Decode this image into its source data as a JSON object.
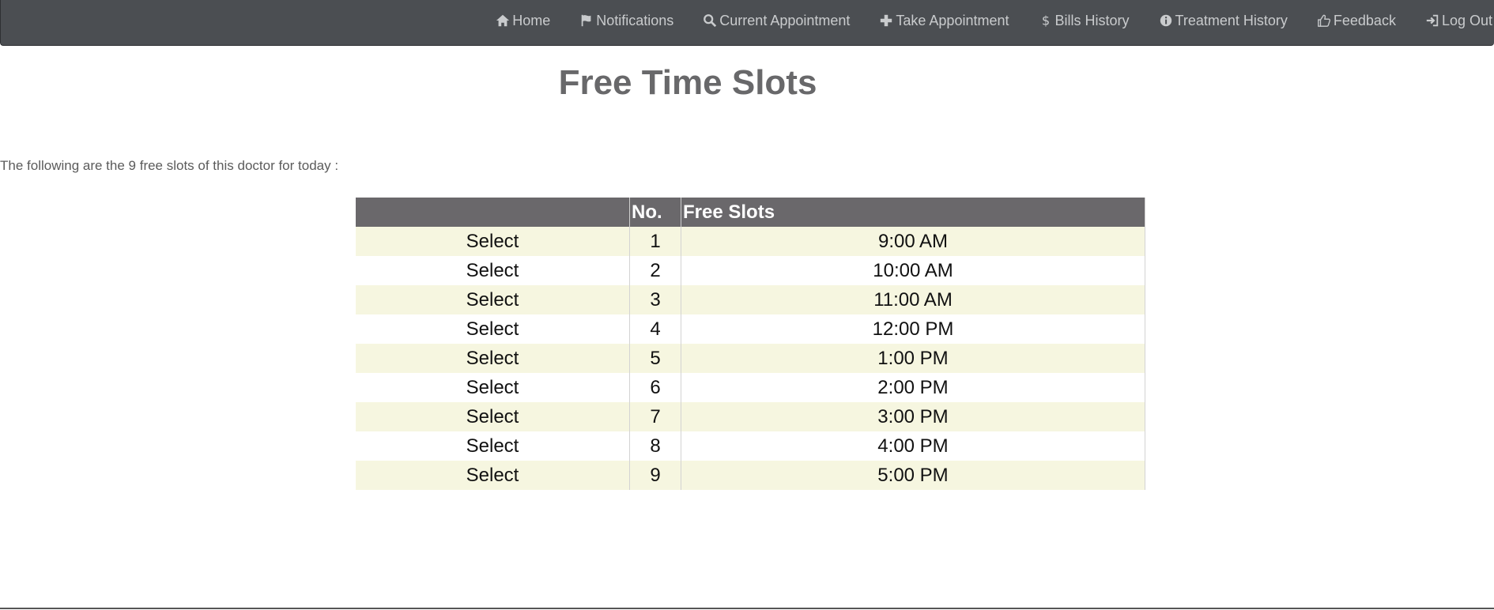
{
  "nav": {
    "items": [
      {
        "label": "Home",
        "icon": "home-icon"
      },
      {
        "label": "Notifications",
        "icon": "flag-icon"
      },
      {
        "label": "Current Appointment",
        "icon": "search-icon"
      },
      {
        "label": "Take Appointment",
        "icon": "plus-icon"
      },
      {
        "label": "Bills History",
        "icon": "dollar-icon"
      },
      {
        "label": "Treatment History",
        "icon": "info-icon"
      },
      {
        "label": "Feedback",
        "icon": "thumbs-up-icon"
      },
      {
        "label": "Log Out",
        "icon": "log-out-icon"
      }
    ]
  },
  "page": {
    "title": "Free Time Slots",
    "intro": "The following are the 9 free slots of this doctor for today :"
  },
  "table": {
    "headers": [
      "",
      "No.",
      "Free Slots"
    ],
    "rows": [
      {
        "action": "Select",
        "no": "1",
        "slot": "9:00 AM"
      },
      {
        "action": "Select",
        "no": "2",
        "slot": "10:00 AM"
      },
      {
        "action": "Select",
        "no": "3",
        "slot": "11:00 AM"
      },
      {
        "action": "Select",
        "no": "4",
        "slot": "12:00 PM"
      },
      {
        "action": "Select",
        "no": "5",
        "slot": "1:00 PM"
      },
      {
        "action": "Select",
        "no": "6",
        "slot": "2:00 PM"
      },
      {
        "action": "Select",
        "no": "7",
        "slot": "3:00 PM"
      },
      {
        "action": "Select",
        "no": "8",
        "slot": "4:00 PM"
      },
      {
        "action": "Select",
        "no": "9",
        "slot": "5:00 PM"
      }
    ]
  },
  "colors": {
    "navbar": "#4b4e52",
    "header": "#6a686b",
    "row_alt": "#f6f6e0"
  }
}
